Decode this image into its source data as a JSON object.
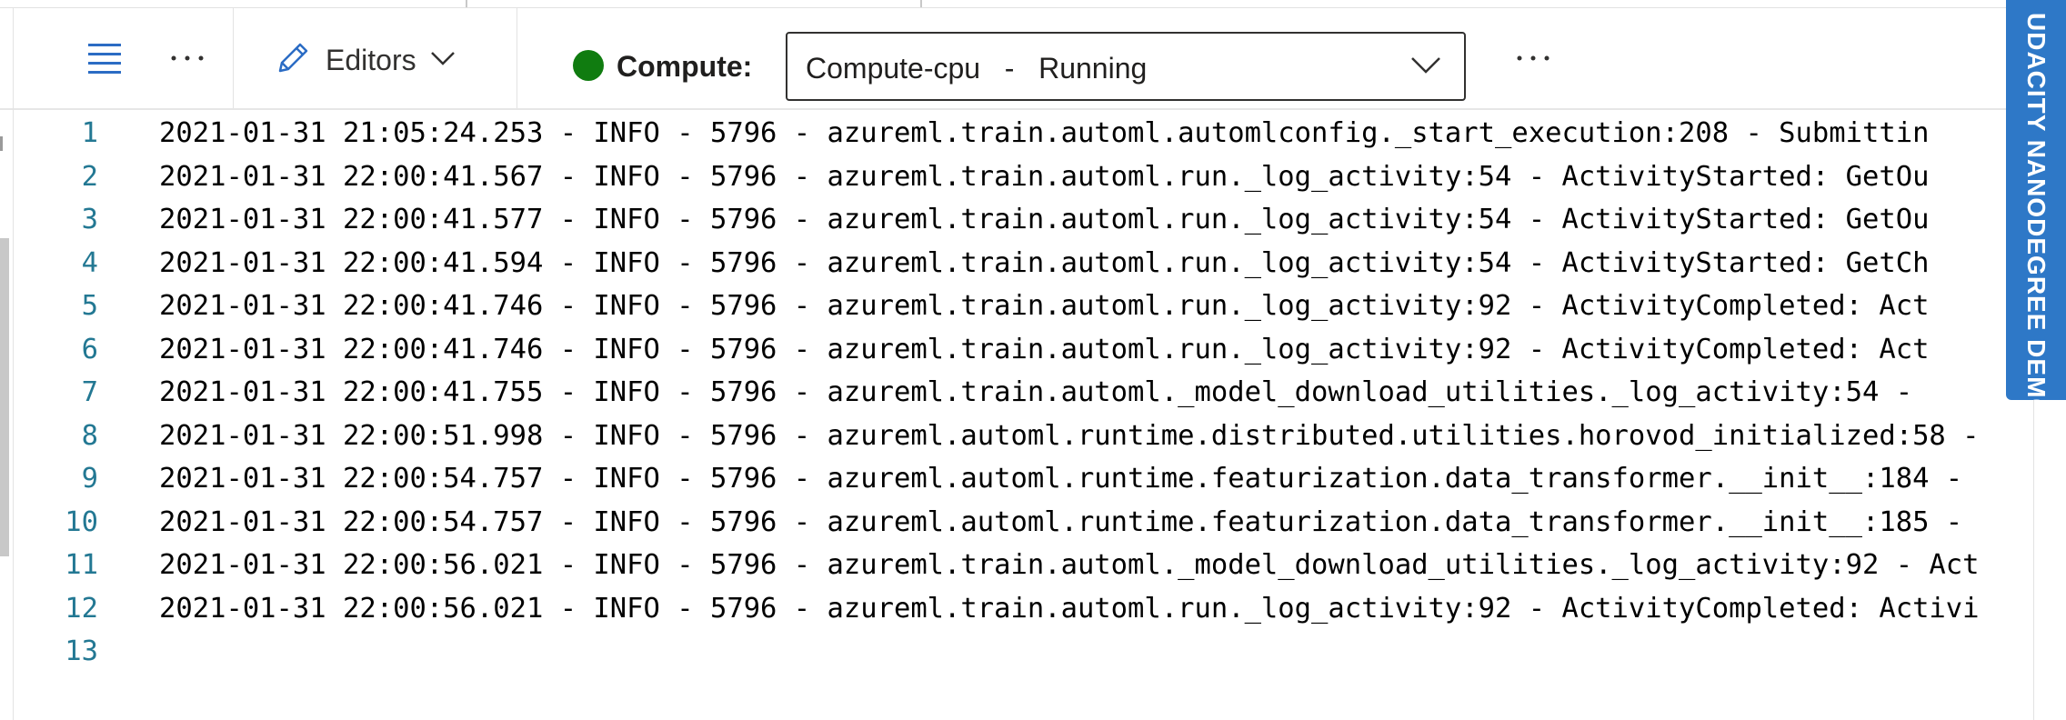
{
  "toolbar": {
    "editors_label": "Editors",
    "compute_label": "Compute:",
    "compute_value": "Compute-cpu   -   Running",
    "compute_status_color": "#107c10"
  },
  "banner": {
    "text": "UDACITY NANODEGREE DEMO",
    "color": "#2e78c7"
  },
  "editor": {
    "lines": [
      {
        "n": "1",
        "text": "2021-01-31 21:05:24.253 - INFO - 5796 - azureml.train.automl.automlconfig._start_execution:208 - Submittin"
      },
      {
        "n": "2",
        "text": "2021-01-31 22:00:41.567 - INFO - 5796 - azureml.train.automl.run._log_activity:54 - ActivityStarted: GetOu"
      },
      {
        "n": "3",
        "text": "2021-01-31 22:00:41.577 - INFO - 5796 - azureml.train.automl.run._log_activity:54 - ActivityStarted: GetOu"
      },
      {
        "n": "4",
        "text": "2021-01-31 22:00:41.594 - INFO - 5796 - azureml.train.automl.run._log_activity:54 - ActivityStarted: GetCh"
      },
      {
        "n": "5",
        "text": "2021-01-31 22:00:41.746 - INFO - 5796 - azureml.train.automl.run._log_activity:92 - ActivityCompleted: Act"
      },
      {
        "n": "6",
        "text": "2021-01-31 22:00:41.746 - INFO - 5796 - azureml.train.automl.run._log_activity:92 - ActivityCompleted: Act"
      },
      {
        "n": "7",
        "text": "2021-01-31 22:00:41.755 - INFO - 5796 - azureml.train.automl._model_download_utilities._log_activity:54 - "
      },
      {
        "n": "8",
        "text": "2021-01-31 22:00:51.998 - INFO - 5796 - azureml.automl.runtime.distributed.utilities.horovod_initialized:58 -"
      },
      {
        "n": "9",
        "text": "2021-01-31 22:00:54.757 - INFO - 5796 - azureml.automl.runtime.featurization.data_transformer.__init__:184 -"
      },
      {
        "n": "10",
        "text": "2021-01-31 22:00:54.757 - INFO - 5796 - azureml.automl.runtime.featurization.data_transformer.__init__:185 -"
      },
      {
        "n": "11",
        "text": "2021-01-31 22:00:56.021 - INFO - 5796 - azureml.train.automl._model_download_utilities._log_activity:92 - Act"
      },
      {
        "n": "12",
        "text": "2021-01-31 22:00:56.021 - INFO - 5796 - azureml.train.automl.run._log_activity:92 - ActivityCompleted: Activi"
      },
      {
        "n": "13",
        "text": ""
      }
    ]
  }
}
